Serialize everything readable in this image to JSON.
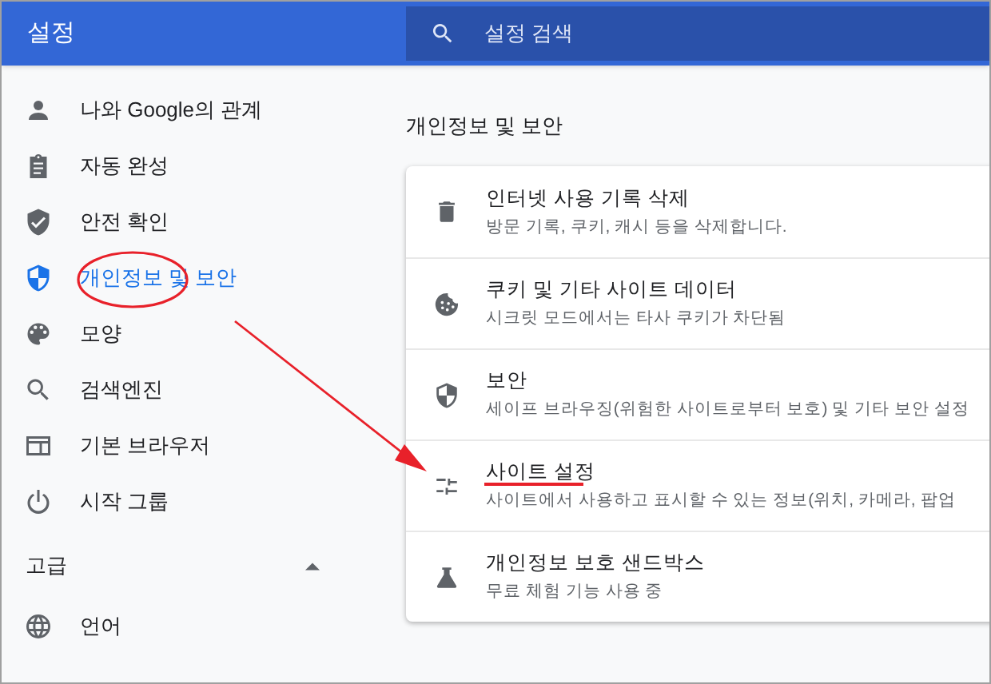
{
  "header": {
    "title": "설정",
    "search": {
      "placeholder": "설정 검색"
    }
  },
  "sidebar": {
    "items": [
      {
        "kind": "person",
        "label": "나와 Google의 관계",
        "selected": false
      },
      {
        "kind": "clipboard",
        "label": "자동 완성",
        "selected": false
      },
      {
        "kind": "shield-check",
        "label": "안전 확인",
        "selected": false
      },
      {
        "kind": "shield-half",
        "label": "개인정보 및 보안",
        "selected": true
      },
      {
        "kind": "palette",
        "label": "모양",
        "selected": false
      },
      {
        "kind": "search",
        "label": "검색엔진",
        "selected": false
      },
      {
        "kind": "browser",
        "label": "기본 브라우저",
        "selected": false
      },
      {
        "kind": "power",
        "label": "시작 그룹",
        "selected": false
      }
    ],
    "advanced": {
      "label": "고급",
      "expanded": true
    },
    "advanced_items": [
      {
        "kind": "globe",
        "label": "언어",
        "selected": false
      }
    ]
  },
  "main": {
    "section_title": "개인정보 및 보안",
    "rows": [
      {
        "kind": "trash",
        "title": "인터넷 사용 기록 삭제",
        "subtitle": "방문 기록, 쿠키, 캐시 등을 삭제합니다."
      },
      {
        "kind": "cookie",
        "title": "쿠키 및 기타 사이트 데이터",
        "subtitle": "시크릿 모드에서는 타사 쿠키가 차단됨"
      },
      {
        "kind": "shield-half",
        "title": "보안",
        "subtitle": "세이프 브라우징(위험한 사이트로부터 보호) 및 기타 보안 설정"
      },
      {
        "kind": "tune",
        "title": "사이트 설정",
        "subtitle": "사이트에서 사용하고 표시할 수 있는 정보(위치, 카메라, 팝업"
      },
      {
        "kind": "flask",
        "title": "개인정보 보호 샌드박스",
        "subtitle": "무료 체험 기능 사용 중"
      }
    ]
  }
}
